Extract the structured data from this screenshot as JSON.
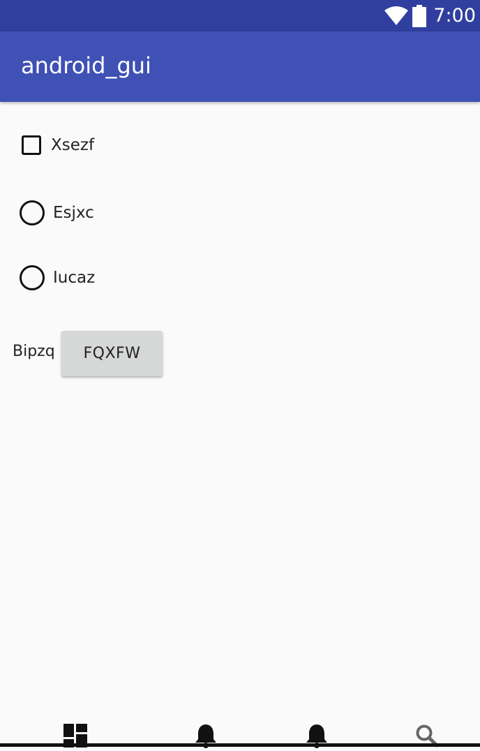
{
  "status_bar": {
    "time": "7:00",
    "icons": [
      "wifi-icon",
      "battery-icon"
    ]
  },
  "app_bar": {
    "title": "android_gui"
  },
  "form": {
    "checkbox": {
      "label": "Xsezf",
      "checked": false
    },
    "radios": [
      {
        "label": "Esjxc",
        "checked": false
      },
      {
        "label": "Iucaz",
        "checked": false
      }
    ],
    "inline_label": "Bipzq",
    "button_label": "FQXFW"
  },
  "bottom_nav": {
    "items": [
      "dashboard-icon",
      "notifications-icon",
      "notifications-icon",
      "search-icon"
    ]
  },
  "colors": {
    "status_bar": "#303f9f",
    "app_bar": "#3f51b5",
    "background": "#fafafa",
    "button": "#d6d7d7"
  }
}
